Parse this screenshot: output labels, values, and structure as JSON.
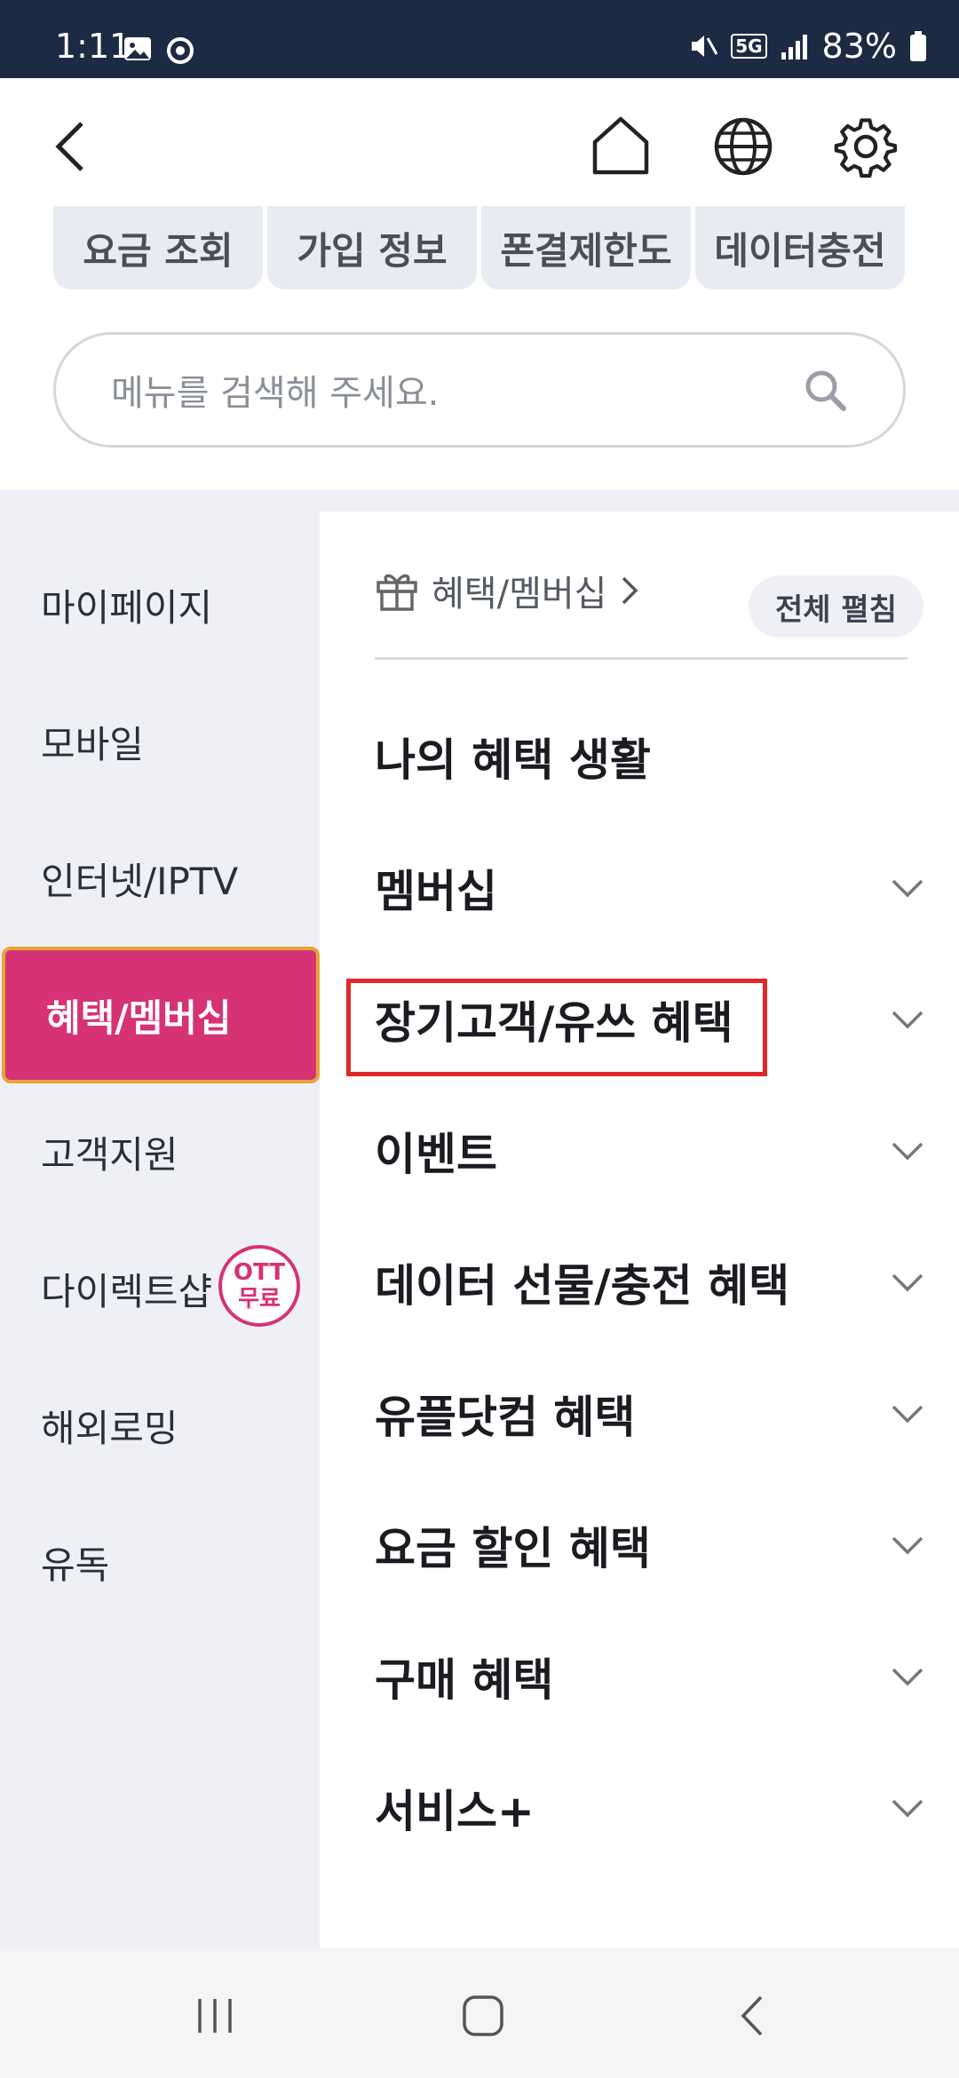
{
  "status": {
    "time": "1:11",
    "network": "5G",
    "battery": "83%"
  },
  "header": {
    "back_icon": "chevron-left-icon",
    "home_icon": "home-icon",
    "globe_icon": "globe-icon",
    "settings_icon": "gear-icon"
  },
  "quick_tabs": [
    "요금 조회",
    "가입 정보",
    "폰결제한도",
    "데이터충전"
  ],
  "search": {
    "placeholder": "메뉴를 검색해 주세요."
  },
  "sidebar": {
    "items": [
      "마이페이지",
      "모바일",
      "인터넷/IPTV",
      "혜택/멤버십",
      "고객지원",
      "다이렉트샵",
      "해외로밍",
      "유독"
    ],
    "active_index": 3,
    "badge_line1": "OTT",
    "badge_line2": "무료"
  },
  "content": {
    "breadcrumb": "혜택/멤버십",
    "expand_all": "전체 펼침",
    "menu": [
      "나의 혜택 생활",
      "멤버십",
      "장기고객/유쓰 혜택",
      "이벤트",
      "데이터 선물/충전 혜택",
      "유플닷컴 혜택",
      "요금 할인 혜택",
      "구매 혜택",
      "서비스+"
    ]
  },
  "colors": {
    "accent": "#d63276",
    "status_bar": "#1c2a44",
    "highlight": "#e02828"
  }
}
